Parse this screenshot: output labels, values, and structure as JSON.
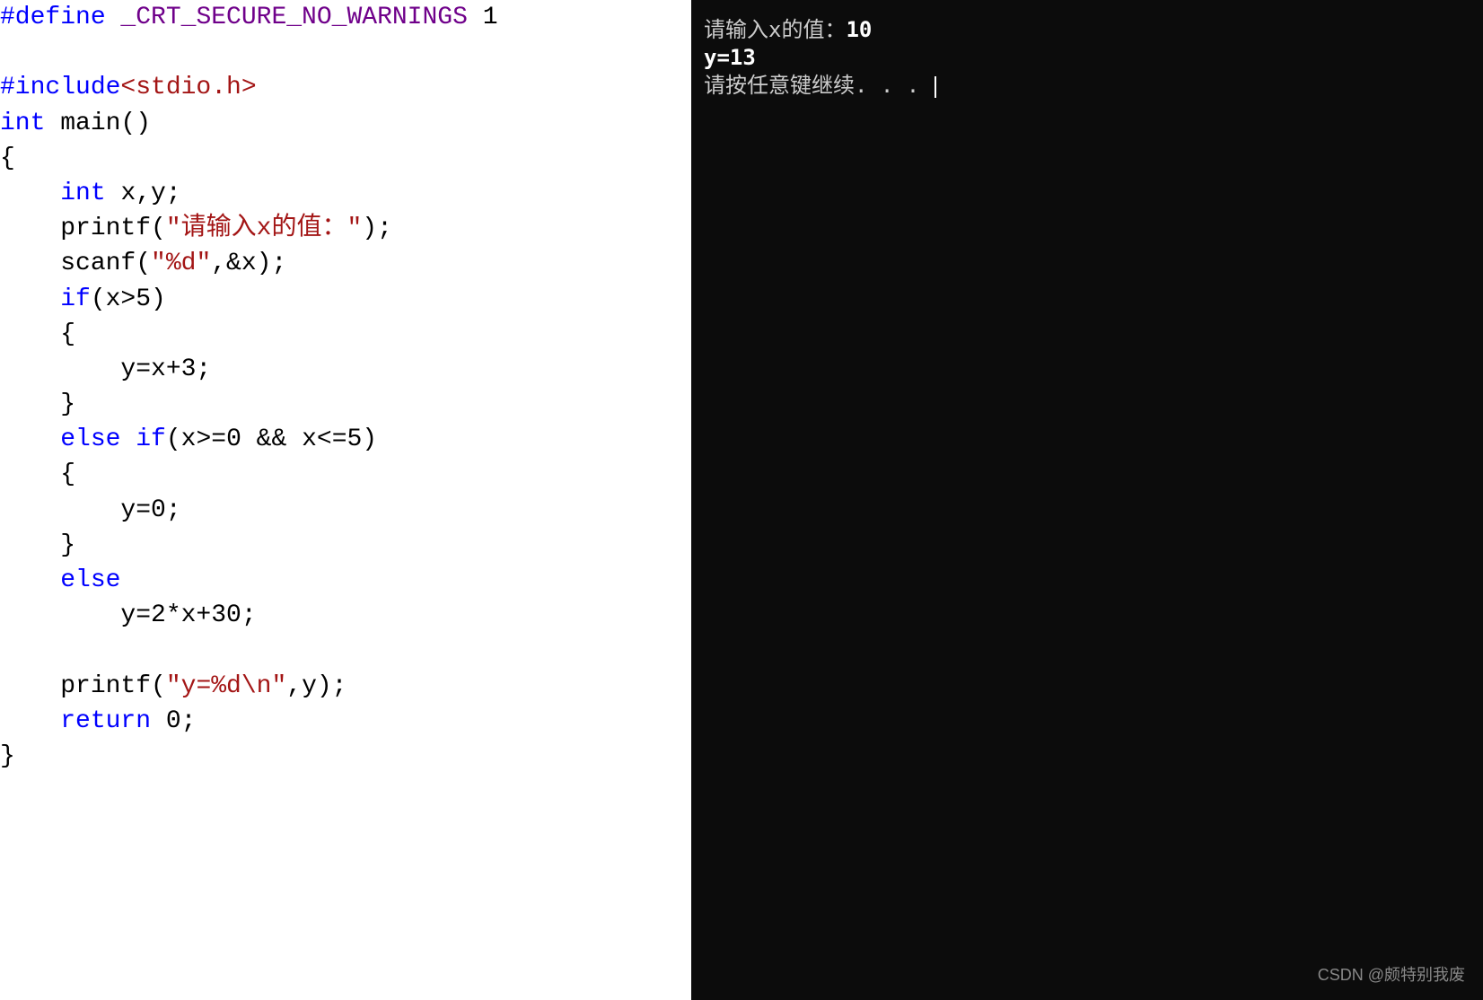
{
  "code": {
    "l1_define": "#define",
    "l1_macro": " _CRT_SECURE_NO_WARNINGS",
    "l1_val": " 1",
    "l2": "",
    "l3_inc": "#include",
    "l3_path": "<stdio.h>",
    "l4_type": "int",
    "l4_main": " main()",
    "l5": "{",
    "l6a": "    ",
    "l6_type": "int",
    "l6b": " x,y;",
    "l7a": "    printf(",
    "l7_str": "\"请输入x的值：\"",
    "l7b": ");",
    "l8a": "    scanf(",
    "l8_str": "\"%d\"",
    "l8b": ",&x);",
    "l9a": "    ",
    "l9_if": "if",
    "l9b": "(x>5)",
    "l10": "    {",
    "l11": "        y=x+3;",
    "l12": "    }",
    "l13a": "    ",
    "l13_else": "else",
    "l13b": " ",
    "l13_if": "if",
    "l13c": "(x>=0 && x<=5)",
    "l14": "    {",
    "l15": "        y=0;",
    "l16": "    }",
    "l17a": "    ",
    "l17_else": "else",
    "l18": "        y=2*x+30;",
    "l19": "",
    "l20a": "    printf(",
    "l20_str": "\"y=%d\\n\"",
    "l20b": ",y);",
    "l21a": "    ",
    "l21_ret": "return",
    "l21b": " 0;",
    "l22": "}"
  },
  "console": {
    "line1_label": "请输入x的值：",
    "line1_input": "10",
    "line2": "y=13",
    "line3": "请按任意键继续. . . "
  },
  "watermark": "CSDN @颇特别我废"
}
